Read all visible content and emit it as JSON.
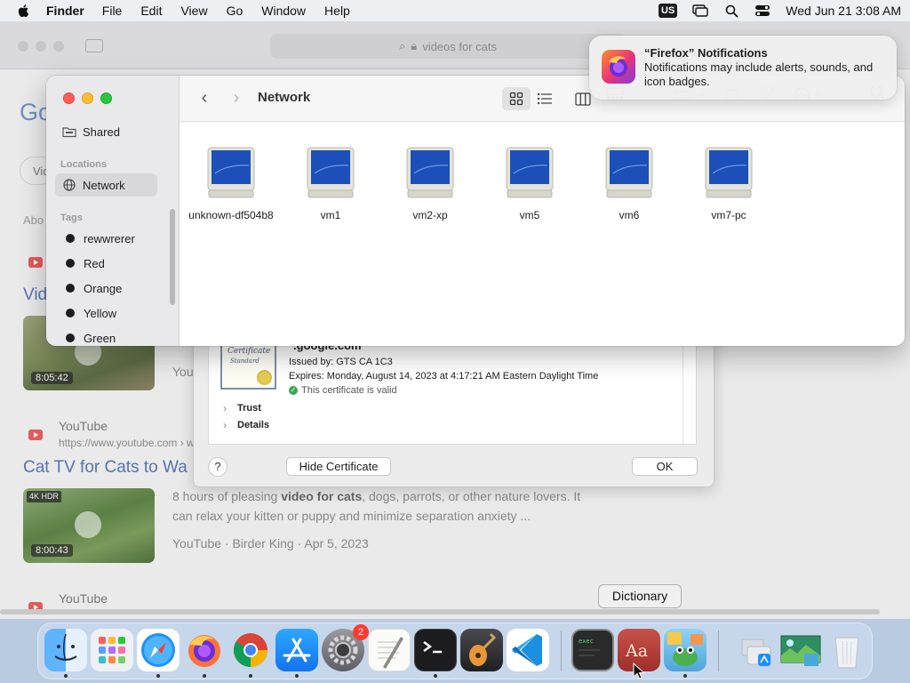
{
  "menubar": {
    "app_name": "Finder",
    "menus": [
      "File",
      "Edit",
      "View",
      "Go",
      "Window",
      "Help"
    ],
    "keyboard": "US",
    "datetime": "Wed Jun 21  3:08 AM"
  },
  "safari": {
    "url_text": "videos for cats",
    "logo_text": "Go",
    "filter_chip": "Vid",
    "about_text": "Abo",
    "result1": {
      "link": "Vid",
      "duration": "8:05:42",
      "snippet_partial": "You"
    },
    "result2": {
      "source": "YouTube",
      "url": "https://www.youtube.com › w",
      "title": "Cat TV for Cats to Wa",
      "duration": "8:00:43",
      "badge": "4K HDR",
      "snippet_line1_pre": "8 hours of pleasing ",
      "snippet_bold": "video for cats",
      "snippet_line1_post": ", dogs, parrots, or other nature lovers. It",
      "snippet_line2": "can relax your kitten or puppy and minimize separation anxiety ...",
      "meta": "YouTube · Birder King · Apr 5, 2023"
    },
    "result3_source": "YouTube"
  },
  "certificate": {
    "image_title": "Certificate",
    "image_subtitle": "Standard",
    "name": "*.google.com",
    "issued_by": "Issued by: GTS CA 1C3",
    "expires": "Expires: Monday, August 14, 2023 at 4:17:21 AM Eastern Daylight Time",
    "valid": "This certificate is valid",
    "trust": "Trust",
    "details": "Details",
    "help": "?",
    "hide_button": "Hide Certificate",
    "ok_button": "OK"
  },
  "finder": {
    "title": "Network",
    "sidebar": {
      "shared": "Shared",
      "locations_header": "Locations",
      "network": "Network",
      "tags_header": "Tags",
      "tags": [
        "rewwrerer",
        "Red",
        "Orange",
        "Yellow",
        "Green"
      ]
    },
    "items": [
      {
        "label": "unknown-df504b8"
      },
      {
        "label": "vm1"
      },
      {
        "label": "vm2-xp"
      },
      {
        "label": "vm5"
      },
      {
        "label": "vm6"
      },
      {
        "label": "vm7-pc"
      }
    ]
  },
  "notification": {
    "title": "“Firefox” Notifications",
    "body": "Notifications may include alerts, sounds, and icon badges."
  },
  "dock": {
    "tooltip": "Dictionary",
    "settings_badge": "2",
    "dictionary_glyph": "Aa",
    "console_glyph": "exec",
    "apps": [
      "Finder",
      "Launchpad",
      "Safari",
      "Firefox",
      "Chrome",
      "App Store",
      "System Settings",
      "TextEdit",
      "Terminal",
      "GarageBand",
      "Visual Studio Code",
      "Console",
      "Dictionary",
      "Frogger",
      "Folder",
      "Preview",
      "Trash"
    ]
  }
}
